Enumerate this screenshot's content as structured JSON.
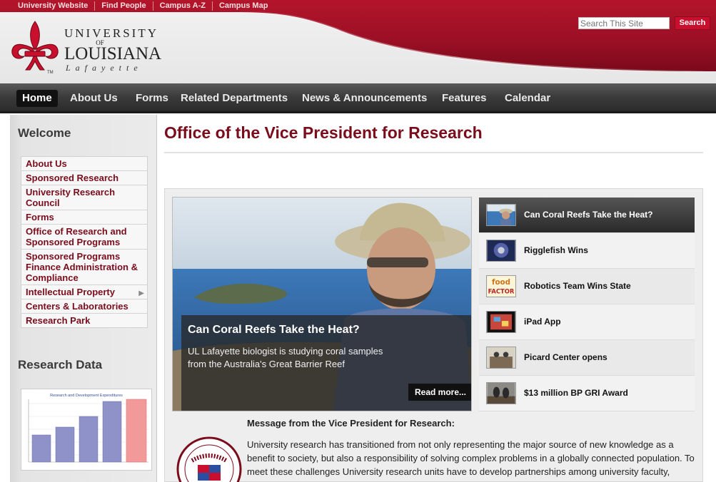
{
  "utility_nav": [
    "University Website",
    "Find People",
    "Campus A-Z",
    "Campus Map"
  ],
  "search": {
    "placeholder": "Search This Site",
    "button_label": "Search"
  },
  "logo": {
    "line1": "UNIVERSITY",
    "line2": "OF",
    "line3": "LOUISIANA",
    "line4": "Lafayette",
    "mark": "™"
  },
  "main_nav": [
    {
      "label": "Home",
      "active": true
    },
    {
      "label": "About Us"
    },
    {
      "label": "Forms"
    },
    {
      "label": "Related Departments"
    },
    {
      "label": "News & Announcements"
    },
    {
      "label": "Features"
    },
    {
      "label": "Calendar"
    }
  ],
  "sidebar": {
    "welcome_heading": "Welcome",
    "items": [
      {
        "label": "About Us"
      },
      {
        "label": "Sponsored Research"
      },
      {
        "label": "University Research Council"
      },
      {
        "label": "Forms"
      },
      {
        "label": "Office of Research and Sponsored Programs"
      },
      {
        "label": "Sponsored Programs Finance Administration & Compliance"
      },
      {
        "label": "Intellectual Property",
        "has_submenu": true
      },
      {
        "label": "Centers & Laboratories"
      },
      {
        "label": "Research Park"
      }
    ],
    "research_data_heading": "Research Data",
    "chart_title": "Research and Development Expenditures"
  },
  "page_title": "Office of the Vice President for Research",
  "hero": {
    "title": "Can Coral Reefs Take the Heat?",
    "text": "UL Lafayette biologist is studying coral samples from the Australia's Great Barrier Reef",
    "read_more": "Read more..."
  },
  "stories": [
    {
      "label": "Can Coral Reefs Take the Heat?",
      "active": true,
      "thumb": "coral-researcher-thumb"
    },
    {
      "label": "Rigglefish Wins",
      "thumb": "rigglefish-thumb"
    },
    {
      "label": "Robotics Team Wins State",
      "thumb": "food-factor-thumb",
      "thumb_text": "food FACTOR"
    },
    {
      "label": "iPad App",
      "thumb": "ipad-thumb"
    },
    {
      "label": "Picard Center opens",
      "thumb": "picard-center-thumb"
    },
    {
      "label": "$13 million BP GRI Award",
      "thumb": "bp-award-thumb"
    }
  ],
  "message": {
    "heading": "Message from the Vice President for Research:",
    "body": "University research has transitioned from not only representing the major source of new knowledge as a benefit to society, but also a responsibility of solving complex problems in a globally connected population. To meet these challenges University research units have to develop partnerships among university faculty,"
  },
  "colors": {
    "brand_red": "#c8102e",
    "title_red": "#7a0c1c",
    "nav_dark": "#2b2b2b"
  }
}
